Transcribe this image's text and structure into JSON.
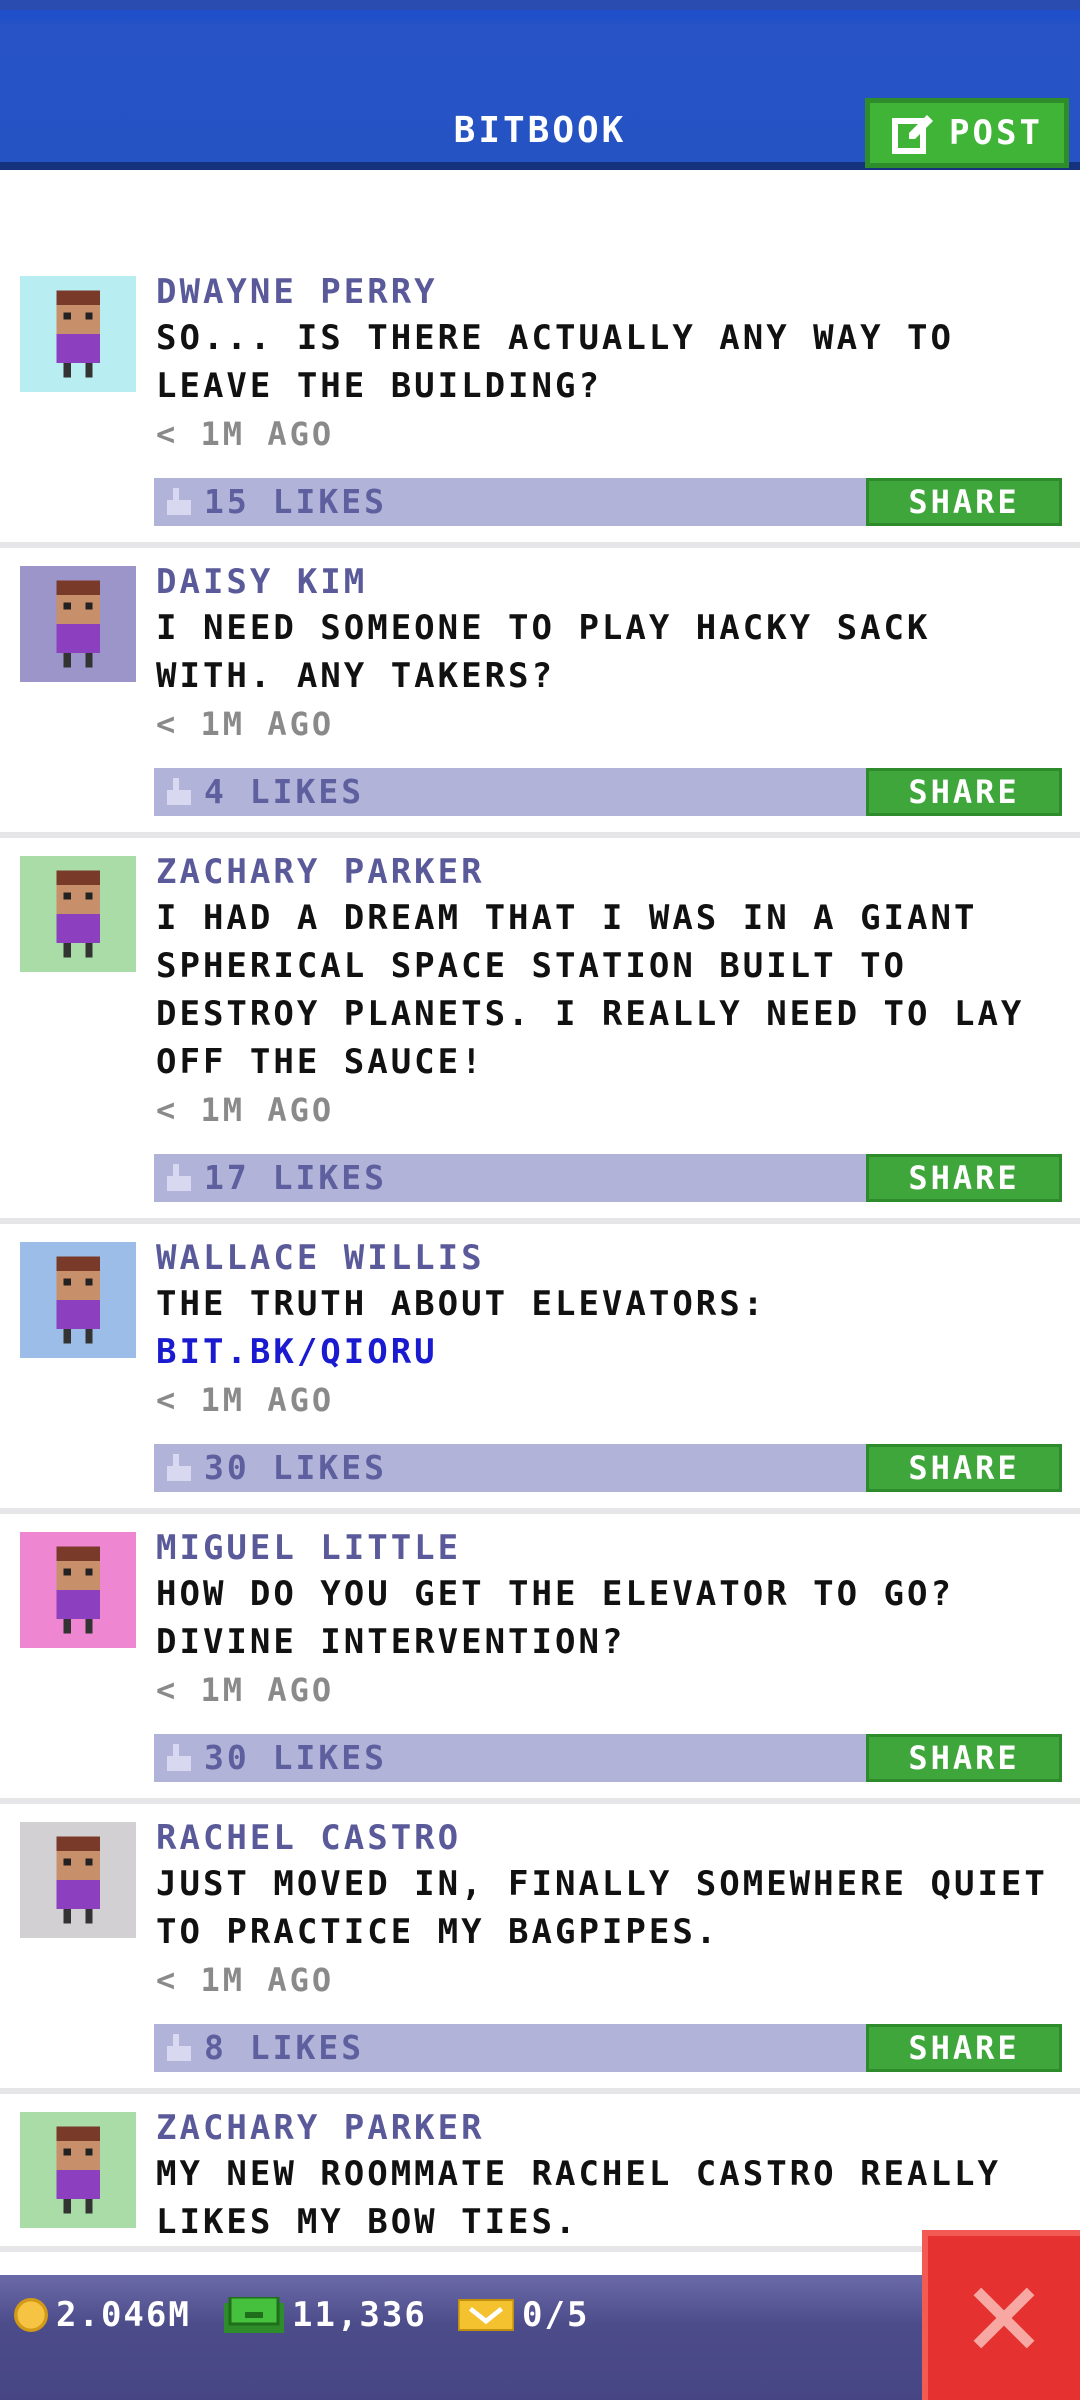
{
  "header": {
    "title": "BITBOOK",
    "post_label": "POST",
    "post_icon": "edit-icon"
  },
  "posts": [
    {
      "author": "DWAYNE PERRY",
      "text": "SO... IS THERE ACTUALLY ANY WAY TO LEAVE THE BUILDING?",
      "link": "",
      "time": "< 1M AGO",
      "likes": "15 LIKES",
      "share": "SHARE",
      "avatar_bg": "#b8eef1"
    },
    {
      "author": "DAISY KIM",
      "text": "I NEED SOMEONE TO PLAY HACKY SACK WITH. ANY TAKERS?",
      "link": "",
      "time": "< 1M AGO",
      "likes": "4 LIKES",
      "share": "SHARE",
      "avatar_bg": "#9b95c9"
    },
    {
      "author": "ZACHARY PARKER",
      "text": "I HAD A DREAM THAT I WAS IN A GIANT SPHERICAL SPACE STATION BUILT TO DESTROY PLANETS. I REALLY NEED TO LAY OFF THE SAUCE!",
      "link": "",
      "time": "< 1M AGO",
      "likes": "17 LIKES",
      "share": "SHARE",
      "avatar_bg": "#a9dca6"
    },
    {
      "author": "WALLACE WILLIS",
      "text": "THE TRUTH ABOUT ELEVATORS:",
      "link": "BIT.BK/QIORU",
      "time": "< 1M AGO",
      "likes": "30 LIKES",
      "share": "SHARE",
      "avatar_bg": "#9cbde7"
    },
    {
      "author": "MIGUEL LITTLE",
      "text": "HOW DO YOU GET THE ELEVATOR TO GO? DIVINE INTERVENTION?",
      "link": "",
      "time": "< 1M AGO",
      "likes": "30 LIKES",
      "share": "SHARE",
      "avatar_bg": "#ee86d1"
    },
    {
      "author": "RACHEL CASTRO",
      "text": "JUST MOVED IN, FINALLY SOMEWHERE QUIET TO PRACTICE MY BAGPIPES.",
      "link": "",
      "time": "< 1M AGO",
      "likes": "8 LIKES",
      "share": "SHARE",
      "avatar_bg": "#d3d0d3"
    },
    {
      "author": "ZACHARY PARKER",
      "text": "MY NEW ROOMMATE RACHEL CASTRO REALLY LIKES MY BOW TIES.",
      "link": "",
      "time": "",
      "likes": "",
      "share": "",
      "avatar_bg": "#a9dca6"
    }
  ],
  "footer": {
    "coins": "2.046M",
    "bux": "11,336",
    "tickets": "0/5"
  },
  "colors": {
    "header": "#2553c4",
    "share": "#3ea63a",
    "bar": "#b2b3d8",
    "close": "#e5312f"
  }
}
